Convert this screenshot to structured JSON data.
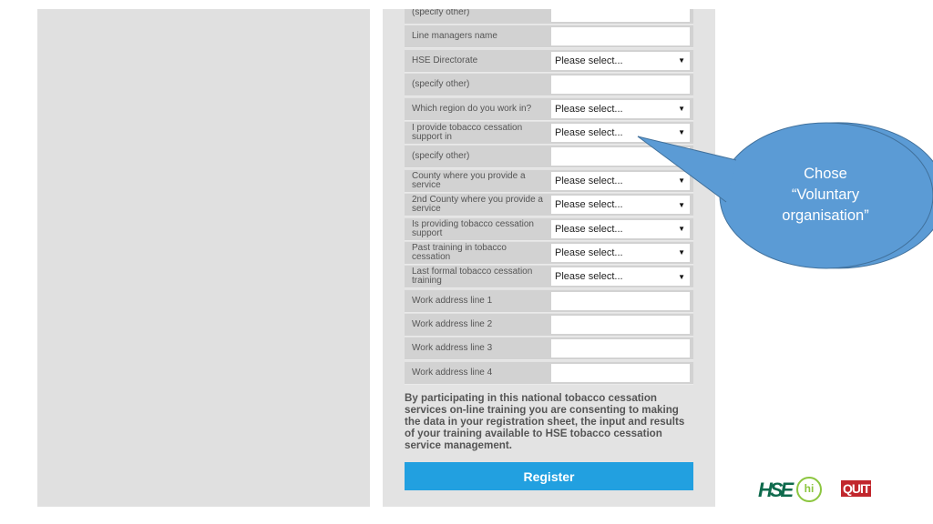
{
  "form": {
    "rows": [
      {
        "label": "(specify other)",
        "type": "text",
        "value": ""
      },
      {
        "label": "Line managers name",
        "type": "text",
        "value": ""
      },
      {
        "label": "HSE Directorate",
        "type": "select",
        "value": "Please select..."
      },
      {
        "label": "(specify other)",
        "type": "text",
        "value": ""
      },
      {
        "label": "Which region do you work in?",
        "type": "select",
        "value": "Please select..."
      },
      {
        "label": "I provide tobacco cessation support in",
        "type": "select",
        "value": "Please select..."
      },
      {
        "label": "(specify other)",
        "type": "text",
        "value": ""
      },
      {
        "label": "County where you provide a service",
        "type": "select",
        "value": "Please select..."
      },
      {
        "label": "2nd County where you provide a service",
        "type": "select",
        "value": "Please select..."
      },
      {
        "label": "Is providing tobacco cessation support",
        "type": "select",
        "value": "Please select..."
      },
      {
        "label": "Past training in tobacco cessation",
        "type": "select",
        "value": "Please select..."
      },
      {
        "label": "Last formal tobacco cessation training",
        "type": "select",
        "value": "Please select..."
      },
      {
        "label": "Work address line 1",
        "type": "text",
        "value": ""
      },
      {
        "label": "Work address line 2",
        "type": "text",
        "value": ""
      },
      {
        "label": "Work address line 3",
        "type": "text",
        "value": ""
      },
      {
        "label": "Work address line 4",
        "type": "text",
        "value": ""
      }
    ],
    "dropdown_arrow": "▼",
    "consent_text": "By participating in this national tobacco cessation services on-line training you are consenting to making the data in your registration sheet, the input and results of your training available to HSE tobacco cessation service management.",
    "register_label": "Register"
  },
  "callout": {
    "lines": [
      "Chose",
      "“Voluntary",
      "organisation”"
    ],
    "color": "#5b9bd5"
  },
  "logos": {
    "hse": "HSE",
    "hi": "hi",
    "quit": "QUIT"
  },
  "colors": {
    "register_button": "#22a0e0",
    "hse_green": "#0e6a4c",
    "hi_green": "#8cc63f",
    "quit_red": "#c1272d"
  }
}
